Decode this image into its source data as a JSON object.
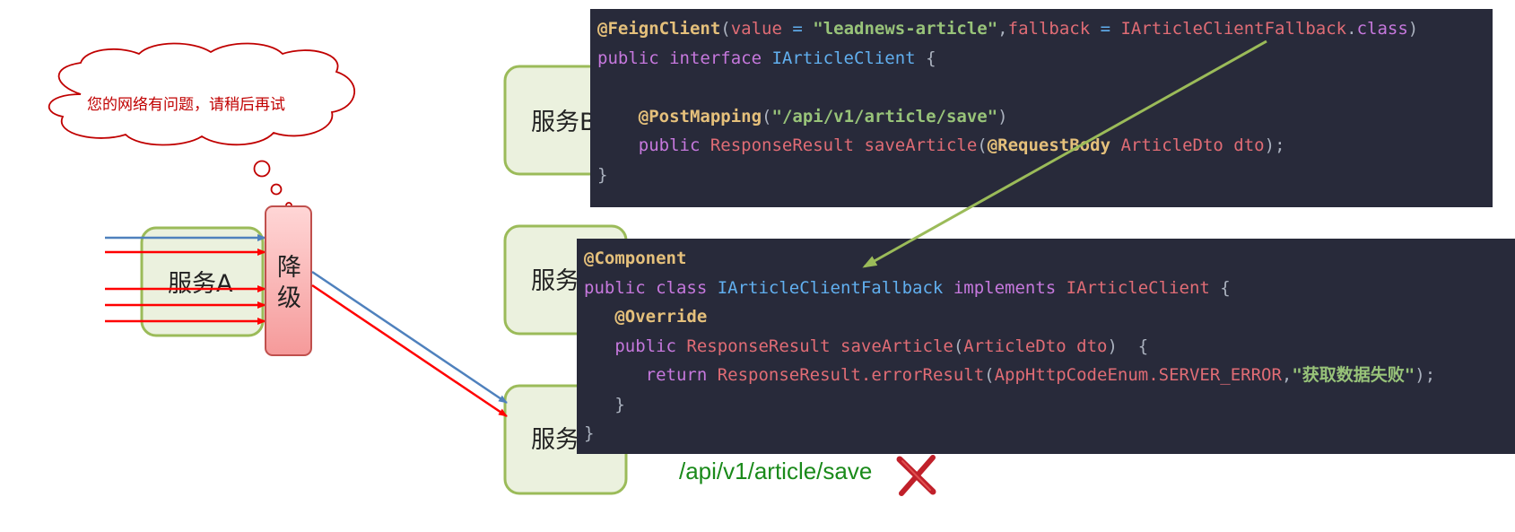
{
  "cloud": {
    "text": "您的网络有问题，请稍后再试"
  },
  "degrade": {
    "label_line1": "降",
    "label_line2": "级"
  },
  "services": {
    "a": "服务A",
    "b": "服务B",
    "c": "服务C",
    "d": "服务D"
  },
  "code_top": {
    "l1_ann": "@FeignClient",
    "l1_p1": "(",
    "l1_value": "value",
    "l1_eq": " = ",
    "l1_str": "\"leadnews-article\"",
    "l1_comma": ",",
    "l1_fallback": "fallback",
    "l1_eq2": " = ",
    "l1_cls": "IArticleClientFallback",
    "l1_dot": ".",
    "l1_class": "class",
    "l1_p2": ")",
    "l2_kw": "public interface ",
    "l2_ty": "IArticleClient",
    "l2_br": " {",
    "l4_ann": "@PostMapping",
    "l4_p1": "(",
    "l4_str": "\"/api/v1/article/save\"",
    "l4_p2": ")",
    "l5_kw": "public ",
    "l5_ty": "ResponseResult",
    "l5_m": " saveArticle",
    "l5_p1": "(",
    "l5_ann": "@RequestBody",
    "l5_ty2": " ArticleDto",
    "l5_arg": " dto",
    "l5_end": ");",
    "l6": "}"
  },
  "code_bottom": {
    "l1_ann": "@Component",
    "l2_kw": "public class ",
    "l2_ty": "IArticleClientFallback",
    "l2_impl": " implements ",
    "l2_ty2": "IArticleClient",
    "l2_br": " {",
    "l3_ann": "@Override",
    "l4_kw": "public ",
    "l4_ty": "ResponseResult",
    "l4_m": " saveArticle",
    "l4_p1": "(",
    "l4_ty2": "ArticleDto",
    "l4_arg": " dto",
    "l4_end": ")  {",
    "l5_kw": "return ",
    "l5_cls": "ResponseResult",
    "l5_m": ".errorResult",
    "l5_p1": "(",
    "l5_enum": "AppHttpCodeEnum.SERVER_ERROR",
    "l5_comma": ",",
    "l5_str": "\"获取数据失败\"",
    "l5_end": ");",
    "l6": "}",
    "l7": "}"
  },
  "path_label": "/api/v1/article/save",
  "colors": {
    "service_fill": "#ebf1de",
    "service_border": "#9bbb59",
    "degrade_fill": "#f9b4b4",
    "degrade_border": "#c0504d",
    "arrow_blue": "#4f81bd",
    "arrow_red": "#ff0000",
    "arrow_green": "#9bbb59",
    "code_bg": "#282a3a",
    "fail_mark": "#c0202a"
  }
}
